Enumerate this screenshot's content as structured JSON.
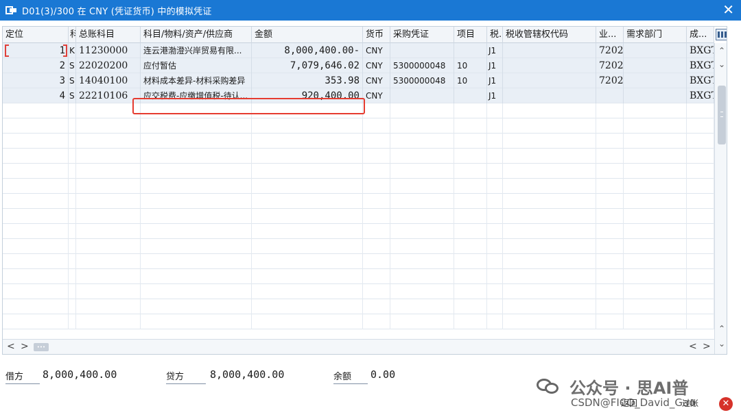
{
  "window": {
    "title": "D01(3)/300 在 CNY (凭证货币) 中的模拟凭证",
    "close_glyph": "✕"
  },
  "table": {
    "columns": [
      "定位",
      "科",
      "总账科目",
      "科目/物料/资产/供应商",
      "金额",
      "货币",
      "采购凭证",
      "项目",
      "税.",
      "税收管辖权代码",
      "业...",
      "需求部门",
      "成..."
    ],
    "rows": [
      {
        "pos": "1",
        "code": "K",
        "account": "11230000",
        "desc": "连云港渤澄兴岸贸易有限...",
        "amount": "8,000,400.00-",
        "currency": "CNY",
        "po": "",
        "item": "",
        "tax": "J1",
        "jurisdiction": "",
        "biz": "7202",
        "dept": "",
        "cost": "BXGT"
      },
      {
        "pos": "2",
        "code": "S",
        "account": "22020200",
        "desc": "应付暂估",
        "amount": "7,079,646.02",
        "currency": "CNY",
        "po": "5300000048",
        "item": "10",
        "tax": "J1",
        "jurisdiction": "",
        "biz": "7202",
        "dept": "",
        "cost": "BXGT"
      },
      {
        "pos": "3",
        "code": "S",
        "account": "14040100",
        "desc": "材料成本差异-材料采购差异",
        "amount": "353.98",
        "currency": "CNY",
        "po": "5300000048",
        "item": "10",
        "tax": "J1",
        "jurisdiction": "",
        "biz": "7202",
        "dept": "",
        "cost": "BXGT"
      },
      {
        "pos": "4",
        "code": "S",
        "account": "22210106",
        "desc": "应交税费-应缴增值税-待认...",
        "amount": "920,400.00",
        "currency": "CNY",
        "po": "",
        "item": "",
        "tax": "J1",
        "jurisdiction": "",
        "biz": "",
        "dept": "",
        "cost": "BXGT"
      }
    ],
    "highlighted_row": 3
  },
  "scroll": {
    "up": "⌃",
    "down": "⌄",
    "left": "<",
    "right": ">",
    "thumb_glyph": "•••"
  },
  "totals": {
    "debit_label": "借方",
    "debit_value": "8,000,400.00",
    "credit_label": "贷方",
    "credit_value": "8,000,400.00",
    "balance_label": "余额",
    "balance_value": "0.00"
  },
  "footer": {
    "watermark": "公众号 · 思AI普",
    "csdn": "CSDN@FICO_David_Gao",
    "btn_back": "返回",
    "btn_process": "过账",
    "close_glyph": "✕"
  }
}
